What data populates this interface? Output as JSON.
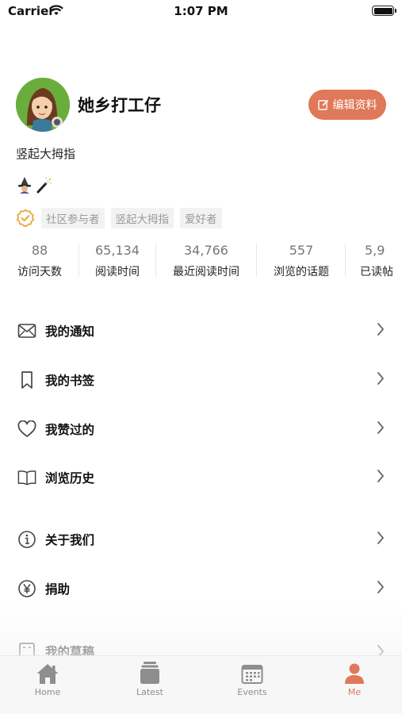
{
  "status_bar": {
    "carrier": "Carrier",
    "time": "1:07 PM"
  },
  "profile": {
    "username": "她乡打工仔",
    "edit_label": "编辑资料",
    "bio": "竖起大拇指",
    "badge_icon": "verified-badge-icon",
    "tags": [
      "社区参与者",
      "竖起大拇指",
      "爱好者"
    ]
  },
  "stats": [
    {
      "value": "88",
      "label": "访问天数"
    },
    {
      "value": "65,134",
      "label": "阅读时间"
    },
    {
      "value": "34,766",
      "label": "最近阅读时间"
    },
    {
      "value": "557",
      "label": "浏览的话题"
    },
    {
      "value": "5,9",
      "label": "已读帖"
    }
  ],
  "menu": [
    {
      "label": "我的通知",
      "icon": "envelope-icon"
    },
    {
      "label": "我的书签",
      "icon": "bookmark-icon"
    },
    {
      "label": "我赞过的",
      "icon": "heart-icon"
    },
    {
      "label": "浏览历史",
      "icon": "book-icon"
    },
    {
      "label": "关于我们",
      "icon": "info-icon"
    },
    {
      "label": "捐助",
      "icon": "yen-icon"
    },
    {
      "label": "我的草稿",
      "icon": "drafts-icon"
    }
  ],
  "tabs": [
    {
      "label": "Home",
      "icon": "house-icon",
      "active": false
    },
    {
      "label": "Latest",
      "icon": "stack-icon",
      "active": false
    },
    {
      "label": "Events",
      "icon": "calendar-icon",
      "active": false
    },
    {
      "label": "Me",
      "icon": "person-icon",
      "active": true
    }
  ],
  "colors": {
    "accent": "#e0785a",
    "tag_bg": "#f2f2f2",
    "tag_text": "#9a9a9a",
    "badge": "#e8a93a"
  }
}
